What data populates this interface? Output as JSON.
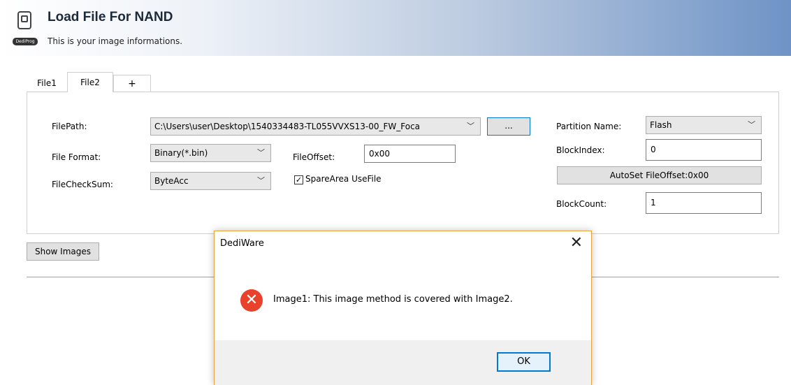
{
  "header": {
    "logo_text": "DediProg",
    "title": "Load File For NAND",
    "subtitle": "This is  your image informations."
  },
  "tabs": [
    {
      "label": "File1",
      "selected": false
    },
    {
      "label": "File2",
      "selected": true
    },
    {
      "label": "+",
      "selected": false
    }
  ],
  "form": {
    "filepath_label": "FilePath:",
    "filepath_value": "C:\\Users\\user\\Desktop\\1540334483-TL055VVXS13-00_FW_Foca",
    "browse_label": "...",
    "format_label": "File Format:",
    "format_value": "Binary(*.bin)",
    "checksum_label": "FileCheckSum:",
    "checksum_value": "ByteAcc",
    "offset_label": "FileOffset:",
    "offset_value": "0x00",
    "spare_checked": true,
    "spare_label": "SpareArea UseFile",
    "partition_label": "Partition Name:",
    "partition_value": "Flash",
    "blockindex_label": "BlockIndex:",
    "blockindex_value": "0",
    "autoset_label": "AutoSet FileOffset:0x00",
    "blockcount_label": "BlockCount:",
    "blockcount_value": "1"
  },
  "show_images_label": "Show Images",
  "dialog": {
    "title": "DediWare",
    "close_glyph": "✕",
    "icon_glyph": "✕",
    "message": "Image1: This image method is covered with Image2.",
    "ok_label": "OK"
  },
  "glyphs": {
    "chevron": "﹀",
    "checkmark": "✓"
  },
  "colors": {
    "header_gradient_end": "#6e93c6",
    "error_red": "#e8412c",
    "focus_blue": "#0078d7",
    "dialog_border": "#e8a33c"
  }
}
